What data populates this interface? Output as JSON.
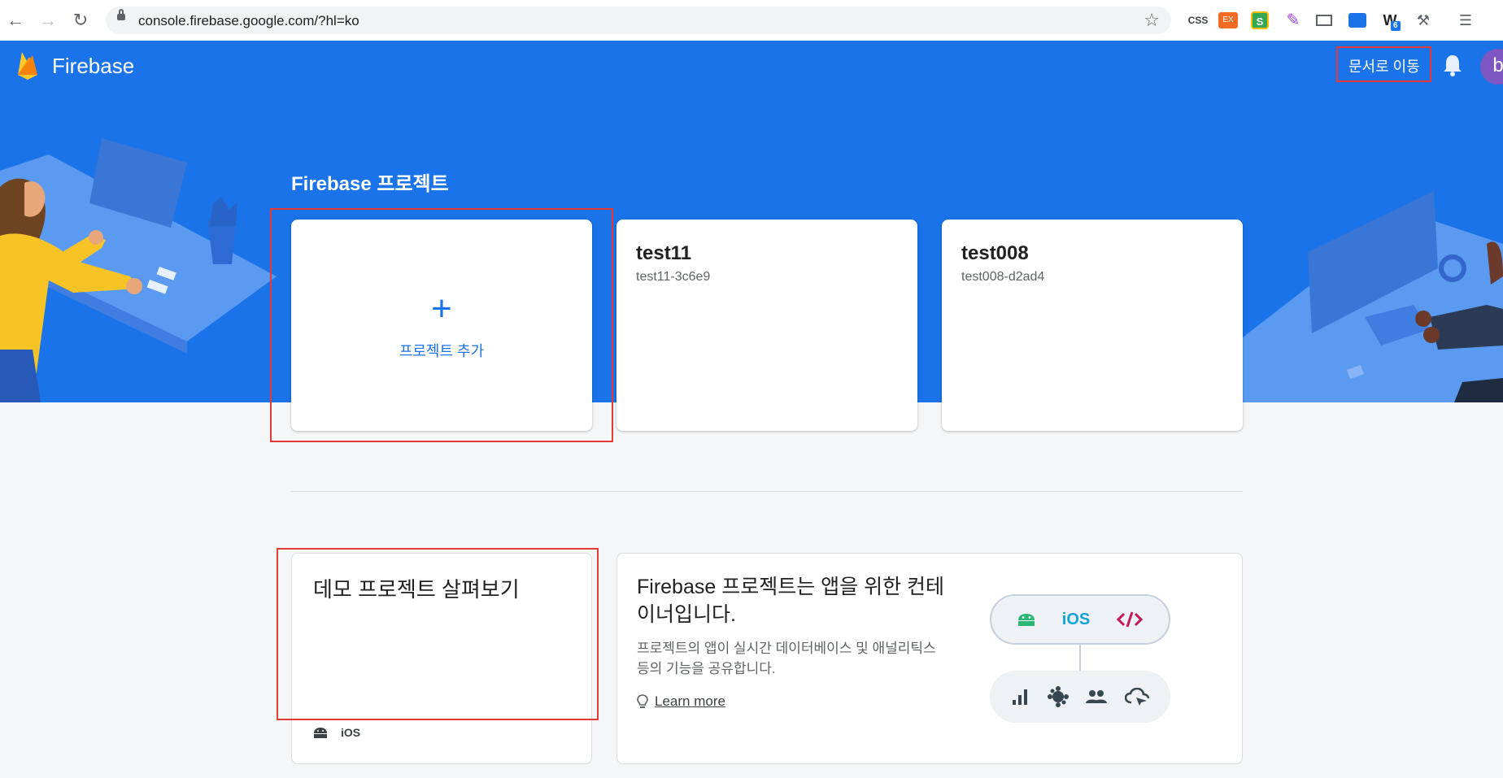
{
  "browser": {
    "url": "console.firebase.google.com/?hl=ko",
    "extensions": [
      {
        "name": "css-extension-icon",
        "label": "CSS",
        "color": "#3c4043"
      },
      {
        "name": "ex-extension-icon",
        "label": "EX",
        "color": "#ea4335"
      },
      {
        "name": "s-extension-icon",
        "label": "S",
        "color": "#34a853"
      },
      {
        "name": "pen-extension-icon",
        "label": "",
        "color": "#a142f4"
      },
      {
        "name": "box-extension-icon",
        "label": "",
        "color": "#5f6368"
      },
      {
        "name": "dark-extension-icon",
        "label": "",
        "color": "#1a73e8"
      },
      {
        "name": "w-extension-icon",
        "label": "W",
        "badge": "6",
        "color": "#202124"
      },
      {
        "name": "paint-extension-icon",
        "label": "",
        "color": "#5f6368"
      },
      {
        "name": "playlist-extension-icon",
        "label": "",
        "color": "#5f6368"
      }
    ]
  },
  "header": {
    "brand": "Firebase",
    "docs_link": "문서로 이동",
    "avatar_letter": "b"
  },
  "main": {
    "title": "Firebase 프로젝트",
    "add_project_label": "프로젝트 추가",
    "projects": [
      {
        "name": "test11",
        "id": "test11-3c6e9"
      },
      {
        "name": "test008",
        "id": "test008-d2ad4"
      }
    ]
  },
  "demo": {
    "title": "데모 프로젝트 살펴보기",
    "platforms": [
      "android",
      "iOS"
    ]
  },
  "info": {
    "title": "Firebase 프로젝트는 앱을 위한 컨테이너입니다.",
    "description": "프로젝트의 앱이 실시간 데이터베이스 및 애널리틱스 등의 기능을 공유합니다.",
    "learn_more": "Learn more",
    "top_platforms": [
      "android",
      "iOS",
      "web"
    ],
    "ios_label": "iOS",
    "features": [
      "analytics",
      "crashlytics",
      "audience",
      "hosting"
    ]
  },
  "colors": {
    "accent": "#1a73e8",
    "highlight": "#e53935",
    "android": "#2bb673",
    "ios": "#11a3d6",
    "web": "#c2185b"
  }
}
